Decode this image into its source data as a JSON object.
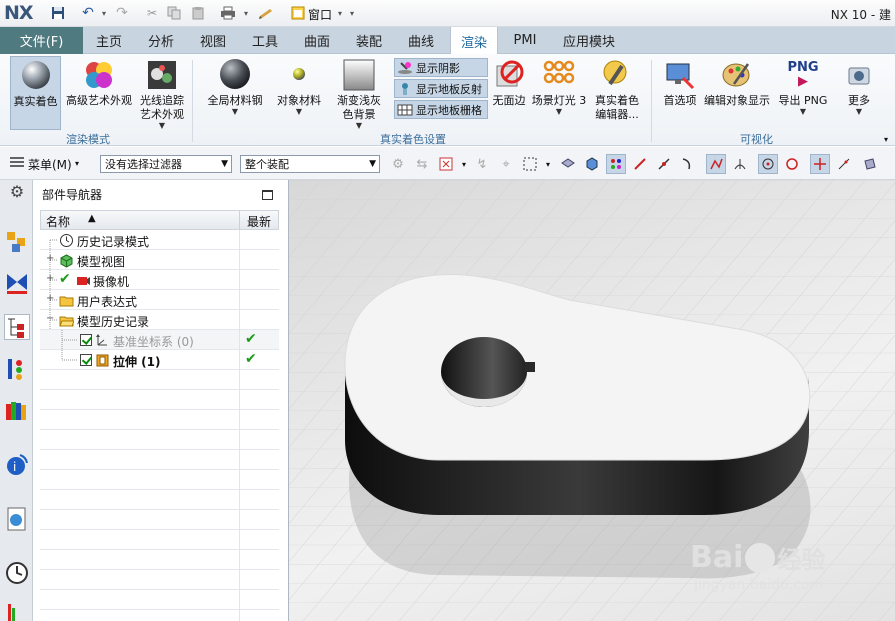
{
  "app": {
    "logo": "NX",
    "version": "NX 10 - 建"
  },
  "quick_access": {
    "window_label": "窗口"
  },
  "menu_tabs": [
    {
      "label": "文件(F)"
    },
    {
      "label": "主页"
    },
    {
      "label": "分析"
    },
    {
      "label": "视图"
    },
    {
      "label": "工具"
    },
    {
      "label": "曲面"
    },
    {
      "label": "装配"
    },
    {
      "label": "曲线"
    },
    {
      "label": "渲染"
    },
    {
      "label": "PMI"
    },
    {
      "label": "应用模块"
    }
  ],
  "ribbon": {
    "render_mode": {
      "group_label": "渲染模式",
      "true_shading": "真实着色",
      "advanced_art": "高级艺术外观",
      "raytrace_line1": "光线追踪",
      "raytrace_line2": "艺术外观"
    },
    "true_shading_settings": {
      "group_label": "真实着色设置",
      "global_material": "全局材料钢",
      "object_material": "对象材料",
      "gradient_line1": "渐变浅灰",
      "gradient_line2": "色背景",
      "show_shadow": "显示阴影",
      "show_floor_reflection": "显示地板反射",
      "show_floor_grid": "显示地板栅格",
      "no_edges": "无面边",
      "scene_light": "场景灯光 3",
      "editor_line1": "真实着色",
      "editor_line2": "编辑器..."
    },
    "visualization": {
      "group_label": "可视化",
      "preferences": "首选项",
      "edit_display": "编辑对象显示",
      "export_png": "导出 PNG",
      "png_icon_text": "PNG",
      "more": "更多"
    }
  },
  "toolbar": {
    "menu_label": "菜单(M)",
    "filter_value": "没有选择过滤器",
    "assembly_value": "整个装配"
  },
  "navigator": {
    "title": "部件导航器",
    "col_name": "名称",
    "col_latest": "最新",
    "items": [
      {
        "label": "历史记录模式"
      },
      {
        "label": "模型视图"
      },
      {
        "label": "摄像机"
      },
      {
        "label": "用户表达式"
      },
      {
        "label": "模型历史记录"
      },
      {
        "label": "基准坐标系 (0)"
      },
      {
        "label": "拉伸 (1)"
      }
    ]
  },
  "watermark": {
    "brand": "Bai",
    "brand2": "经验",
    "url": "jingyan.baidu.com"
  }
}
